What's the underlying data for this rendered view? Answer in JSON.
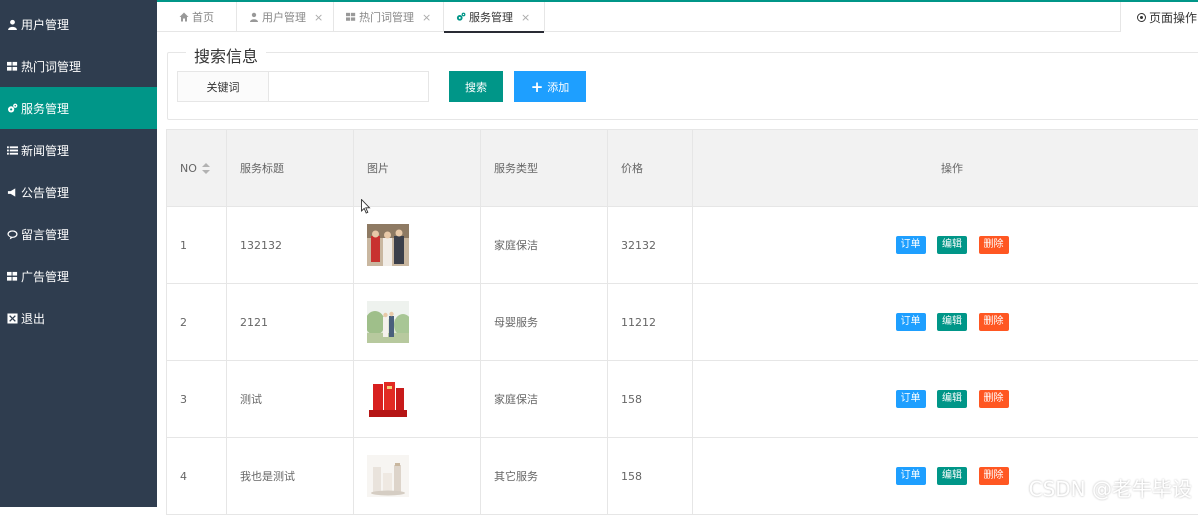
{
  "sidebar": {
    "items": [
      {
        "label": "用户管理",
        "icon": "user-icon"
      },
      {
        "label": "热门词管理",
        "icon": "grid-icon"
      },
      {
        "label": "服务管理",
        "icon": "cogs-icon",
        "active": true
      },
      {
        "label": "新闻管理",
        "icon": "list-icon"
      },
      {
        "label": "公告管理",
        "icon": "bullhorn-icon"
      },
      {
        "label": "留言管理",
        "icon": "comment-icon"
      },
      {
        "label": "广告管理",
        "icon": "grid-icon"
      },
      {
        "label": "退出",
        "icon": "close-box-icon"
      }
    ]
  },
  "tabs": [
    {
      "label": "首页",
      "icon": "home-icon",
      "closable": false
    },
    {
      "label": "用户管理",
      "icon": "user-icon",
      "closable": true
    },
    {
      "label": "热门词管理",
      "icon": "grid-icon",
      "closable": true
    },
    {
      "label": "服务管理",
      "icon": "cogs-icon",
      "closable": true,
      "active": true
    }
  ],
  "tab_close_symbol": "×",
  "page_ops": {
    "label": "页面操作"
  },
  "search": {
    "legend": "搜索信息",
    "keyword_label": "关键词",
    "keyword_value": "",
    "search_button": "搜索",
    "add_button": "添加"
  },
  "table": {
    "columns": [
      "NO",
      "服务标题",
      "图片",
      "服务类型",
      "价格",
      "操作"
    ],
    "rows": [
      {
        "no": "1",
        "title": "132132",
        "image": "wedding-photo",
        "type": "家庭保洁",
        "price": "32132"
      },
      {
        "no": "2",
        "title": "2121",
        "image": "couple-outdoor-photo",
        "type": "母婴服务",
        "price": "11212"
      },
      {
        "no": "3",
        "title": "测试",
        "image": "red-cosmetics-photo",
        "type": "家庭保洁",
        "price": "158"
      },
      {
        "no": "4",
        "title": "我也是测试",
        "image": "white-cosmetics-photo",
        "type": "其它服务",
        "price": "158"
      }
    ],
    "actions": {
      "order": "订单",
      "edit": "编辑",
      "delete": "删除"
    }
  },
  "colors": {
    "sidebar_bg": "#2f3d4f",
    "accent": "#009688",
    "blue": "#1e9fff",
    "danger": "#ff5722"
  },
  "watermark": "CSDN @老牛毕设"
}
